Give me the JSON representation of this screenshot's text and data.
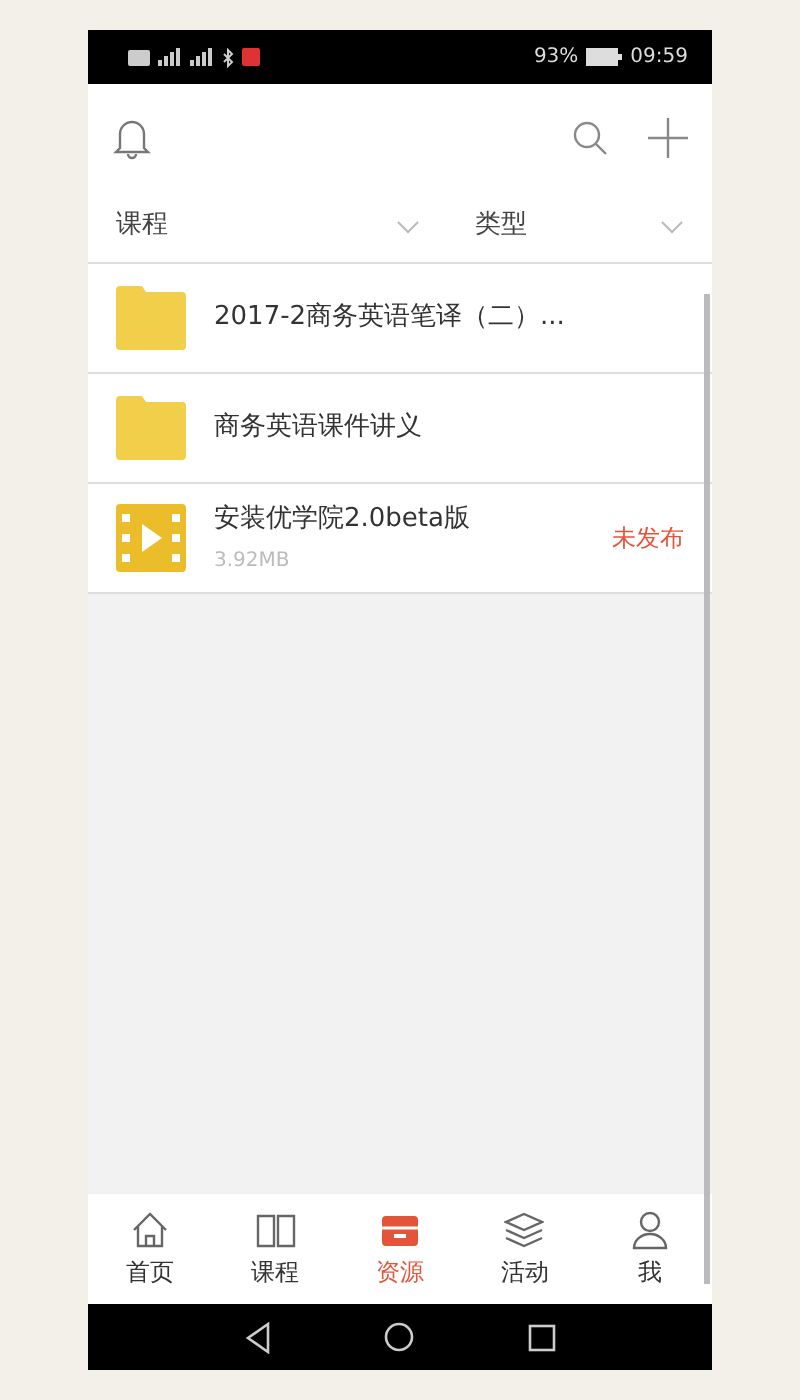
{
  "status_bar": {
    "battery": "93%",
    "time": "09:59"
  },
  "filters": [
    {
      "label": "课程"
    },
    {
      "label": "类型"
    }
  ],
  "items": [
    {
      "kind": "folder",
      "name": "2017-2商务英语笔译（二）..."
    },
    {
      "kind": "folder",
      "name": "商务英语课件讲义"
    },
    {
      "kind": "video",
      "name": "安装优学院2.0beta版",
      "size": "3.92MB",
      "status": "未发布"
    }
  ],
  "tabs": [
    {
      "label": "首页",
      "selected": false
    },
    {
      "label": "课程",
      "selected": false
    },
    {
      "label": "资源",
      "selected": true
    },
    {
      "label": "活动",
      "selected": false
    },
    {
      "label": "我",
      "selected": false
    }
  ]
}
